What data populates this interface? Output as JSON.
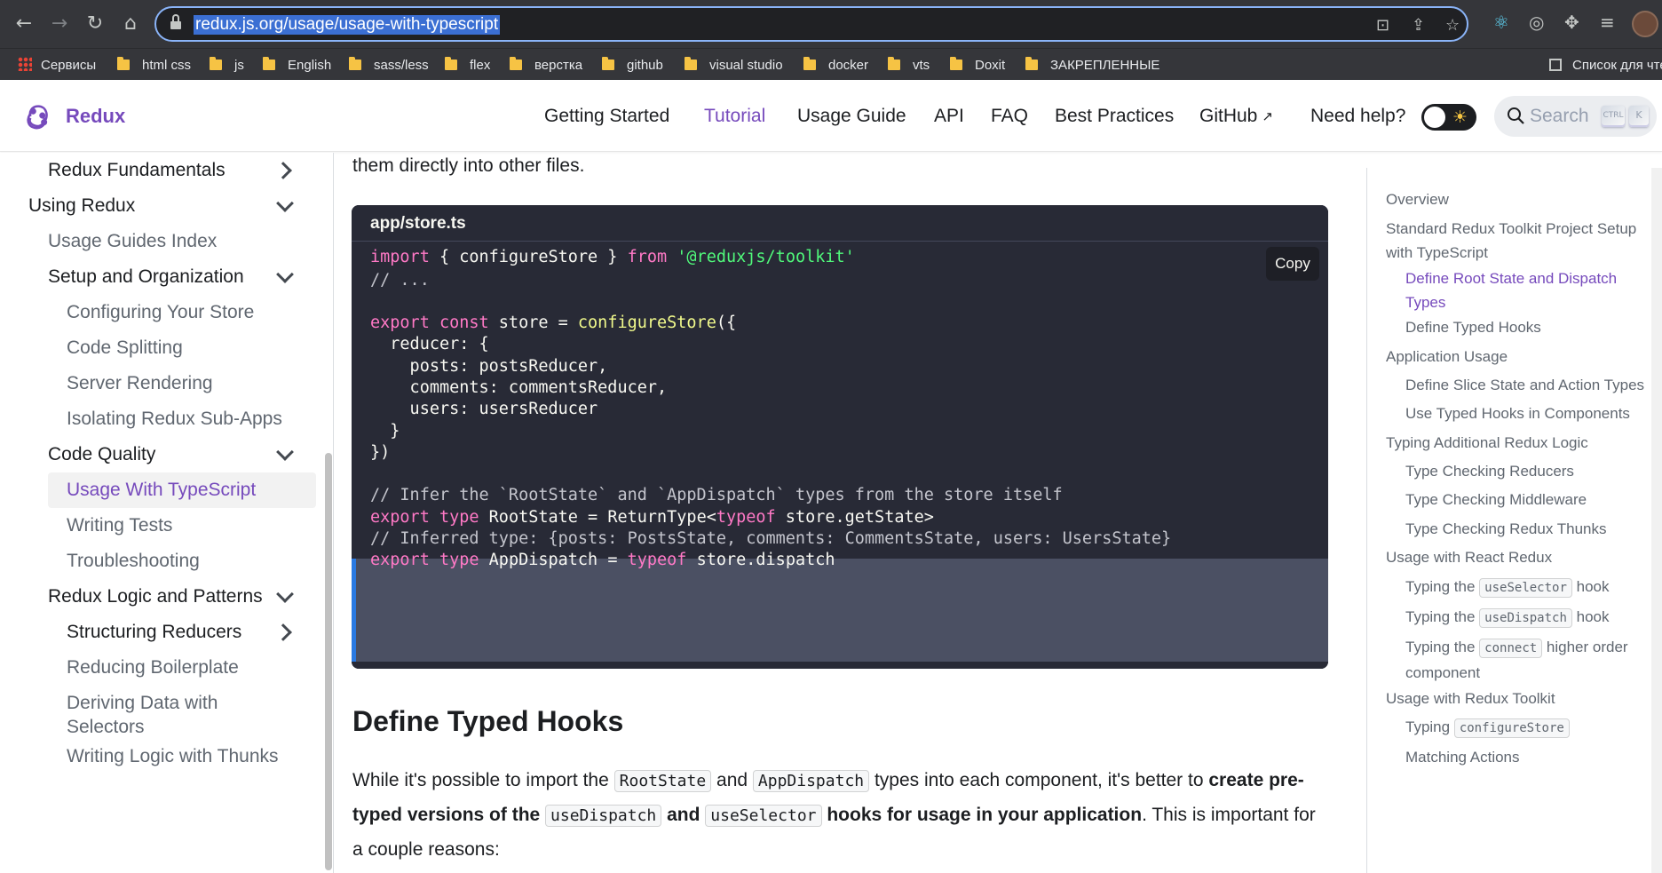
{
  "browser": {
    "url": "redux.js.org/usage/usage-with-typescript",
    "bookmarks": [
      "Сервисы",
      "html css",
      "js",
      "English",
      "sass/less",
      "flex",
      "верстка",
      "github",
      "visual studio",
      "docker",
      "vts",
      "Doxit",
      "ЗАКРЕПЛЕННЫЕ"
    ],
    "reading_list": "Список для чте"
  },
  "navbar": {
    "brand": "Redux",
    "links": [
      "Getting Started",
      "Tutorial",
      "Usage Guide",
      "API",
      "FAQ",
      "Best Practices",
      "GitHub",
      "Need help?"
    ],
    "active_link": "Tutorial",
    "search_placeholder": "Search",
    "search_keys": [
      "CTRL",
      "K"
    ]
  },
  "sidebar": {
    "items": [
      {
        "label": "Redux Fundamentals",
        "caret": "right"
      },
      {
        "label": "Using Redux",
        "caret": "down"
      },
      {
        "label": "Usage Guides Index"
      },
      {
        "label": "Setup and Organization",
        "caret": "down"
      },
      {
        "label": "Configuring Your Store"
      },
      {
        "label": "Code Splitting"
      },
      {
        "label": "Server Rendering"
      },
      {
        "label": "Isolating Redux Sub-Apps"
      },
      {
        "label": "Code Quality",
        "caret": "down"
      },
      {
        "label": "Usage With TypeScript",
        "active": true
      },
      {
        "label": "Writing Tests"
      },
      {
        "label": "Troubleshooting"
      },
      {
        "label": "Redux Logic and Patterns",
        "caret": "down"
      },
      {
        "label": "Structuring Reducers",
        "caret": "right"
      },
      {
        "label": "Reducing Boilerplate"
      },
      {
        "label": "Deriving Data with",
        "label2": "Selectors"
      },
      {
        "label": "Writing Logic with Thunks"
      }
    ]
  },
  "main": {
    "intro_tail": "them directly into other files.",
    "code": {
      "filename": "app/store.ts",
      "copy_label": "Copy",
      "lines": [
        "import { configureStore } from '@reduxjs/toolkit'",
        "// ...",
        "",
        "export const store = configureStore({",
        "  reducer: {",
        "    posts: postsReducer,",
        "    comments: commentsReducer,",
        "    users: usersReducer",
        "  }",
        "})",
        "// Infer the `RootState` and `AppDispatch` types from the store itself",
        "export type RootState = ReturnType<typeof store.getState>",
        "// Inferred type: {posts: PostsState, comments: CommentsState, users: UsersState}",
        "export type AppDispatch = typeof store.dispatch"
      ]
    },
    "heading": "Define Typed Hooks",
    "paragraph": {
      "t1": "While it's possible to import the ",
      "c1": "RootState",
      "t2": " and ",
      "c2": "AppDispatch",
      "t3": " types into each component, it's better to ",
      "b1": "create pre-typed versions of the ",
      "c3": "useDispatch",
      "b2": " and ",
      "c4": "useSelector",
      "b3": " hooks for usage in your application",
      "t4": ". This is important for a couple reasons:"
    }
  },
  "toc": {
    "items": [
      {
        "label": "Overview",
        "level": 1
      },
      {
        "label": "Standard Redux Toolkit Project Setup",
        "label2": "with TypeScript",
        "level": 1
      },
      {
        "label": "Define Root State and Dispatch",
        "label2": "Types",
        "level": 2,
        "active": true
      },
      {
        "label": "Define Typed Hooks",
        "level": 2
      },
      {
        "label": "Application Usage",
        "level": 1
      },
      {
        "label": "Define Slice State and Action Types",
        "level": 2
      },
      {
        "label": "Use Typed Hooks in Components",
        "level": 2
      },
      {
        "label": "Typing Additional Redux Logic",
        "level": 1
      },
      {
        "label": "Type Checking Reducers",
        "level": 2
      },
      {
        "label": "Type Checking Middleware",
        "level": 2
      },
      {
        "label": "Type Checking Redux Thunks",
        "level": 2
      },
      {
        "label": "Usage with React Redux",
        "level": 1
      },
      {
        "label": "Typing the ",
        "code": "useSelector",
        "after": " hook",
        "level": 2
      },
      {
        "label": "Typing the ",
        "code": "useDispatch",
        "after": " hook",
        "level": 2
      },
      {
        "label": "Typing the ",
        "code": "connect",
        "after": " higher order",
        "label2": "component",
        "level": 2
      },
      {
        "label": "Usage with Redux Toolkit",
        "level": 1
      },
      {
        "label": "Typing ",
        "code": "configureStore",
        "level": 2
      },
      {
        "label": "Matching Actions",
        "level": 2
      }
    ]
  },
  "colors": {
    "accent": "#764abc",
    "code_bg": "#282a36",
    "highlight_bg": "#4b5063",
    "keyword": "#ff79c6",
    "function": "#f1fa8c",
    "string": "#50fa7b"
  }
}
